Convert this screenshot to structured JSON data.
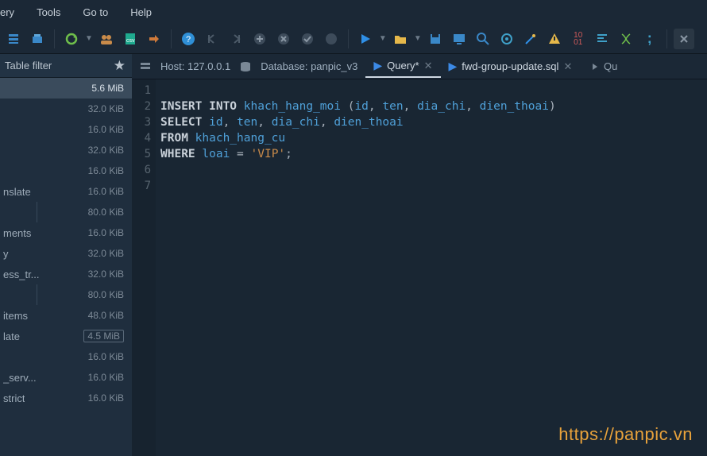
{
  "menus": [
    "ery",
    "Tools",
    "Go to",
    "Help"
  ],
  "host_label": "Host:",
  "host_value": "127.0.0.1",
  "db_label": "Database:",
  "db_value": "panpic_v3",
  "tabs": [
    {
      "label": "Query*",
      "active": true
    },
    {
      "label": "fwd-group-update.sql",
      "active": false
    }
  ],
  "tab_tail": "Qu",
  "filter_label": "Table filter",
  "rows": [
    {
      "name": "",
      "size": "5.6 MiB",
      "sel": true
    },
    {
      "name": "",
      "size": "32.0 KiB"
    },
    {
      "name": "",
      "size": "16.0 KiB"
    },
    {
      "name": "",
      "size": "32.0 KiB"
    },
    {
      "name": "",
      "size": "16.0 KiB"
    },
    {
      "name": "nslate",
      "size": "16.0 KiB"
    },
    {
      "name": "",
      "size": "80.0 KiB",
      "sub": true
    },
    {
      "name": "ments",
      "size": "16.0 KiB"
    },
    {
      "name": "y",
      "size": "32.0 KiB"
    },
    {
      "name": "ess_tr...",
      "size": "32.0 KiB"
    },
    {
      "name": "",
      "size": "80.0 KiB",
      "sub": true
    },
    {
      "name": "items",
      "size": "48.0 KiB"
    },
    {
      "name": "late",
      "size": "4.5 MiB",
      "hi": true
    },
    {
      "name": "",
      "size": "16.0 KiB"
    },
    {
      "name": "_serv...",
      "size": "16.0 KiB"
    },
    {
      "name": "strict",
      "size": "16.0 KiB"
    }
  ],
  "code_lines": [
    {
      "n": 1,
      "html": ""
    },
    {
      "n": 2,
      "html": "<span class='kw'>INSERT INTO</span> <span class='ident'>khach_hang_moi</span> <span class='punct'>(</span><span class='ident'>id</span><span class='punct'>,</span> <span class='ident'>ten</span><span class='punct'>,</span> <span class='ident'>dia_chi</span><span class='punct'>,</span> <span class='ident'>dien_thoai</span><span class='punct'>)</span>"
    },
    {
      "n": 3,
      "html": "<span class='kw'>SELECT</span> <span class='ident'>id</span><span class='punct'>,</span> <span class='ident'>ten</span><span class='punct'>,</span> <span class='ident'>dia_chi</span><span class='punct'>,</span> <span class='ident'>dien_thoai</span>"
    },
    {
      "n": 4,
      "html": "<span class='kw'>FROM</span> <span class='ident'>khach_hang_cu</span>"
    },
    {
      "n": 5,
      "html": "<span class='kw'>WHERE</span> <span class='ident'>loai</span> <span class='op'>=</span> <span class='str'>'VIP'</span><span class='punct'>;</span>"
    },
    {
      "n": 6,
      "html": ""
    },
    {
      "n": 7,
      "html": ""
    }
  ],
  "watermark": "https://panpic.vn"
}
